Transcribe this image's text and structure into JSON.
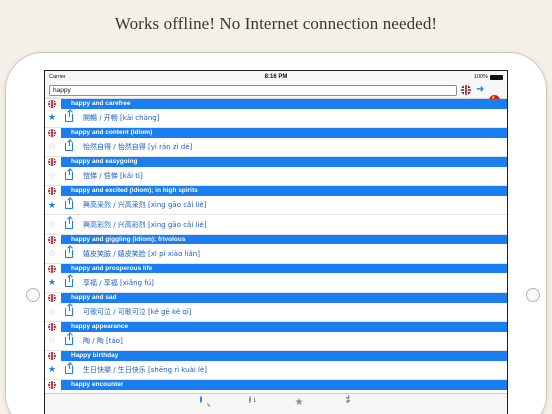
{
  "headline": "Works offline! No Internet connection needed!",
  "statusbar": {
    "carrier": "Carrier",
    "time": "8:16 PM",
    "battery": "100%"
  },
  "search": {
    "value": "happy"
  },
  "colors": {
    "accent": "#1a7df0",
    "background": "#f4f0e9"
  },
  "icons": {
    "source_language": "uk-flag-icon",
    "target_language": "china-flag-icon"
  },
  "rows": [
    {
      "type": "header",
      "text": "happy and carefree"
    },
    {
      "type": "entry",
      "starred": true,
      "text": "開暢 / 开畅 [kāi chàng]"
    },
    {
      "type": "header",
      "text": "happy and content (idiom)"
    },
    {
      "type": "entry",
      "starred": false,
      "text": "怡然自得 / 怡然自得 [yí rán zì dé]"
    },
    {
      "type": "header",
      "text": "happy and easygoing"
    },
    {
      "type": "entry",
      "starred": false,
      "text": "愷悌 / 恺悌 [kǎi tì]"
    },
    {
      "type": "header",
      "text": "happy and excited (idiom); in high spirits"
    },
    {
      "type": "entry",
      "starred": true,
      "text": "興高采烈 / 兴高采烈 [xìng gāo cǎi liè]"
    },
    {
      "type": "entry",
      "starred": false,
      "text": "興高彩烈 / 兴高彩烈 [xìng gāo cǎi liè]"
    },
    {
      "type": "header",
      "text": "happy and giggling (idiom); frivolous"
    },
    {
      "type": "entry",
      "starred": false,
      "text": "嬉皮笑臉 / 嬉皮笑脸 [xī pí xiào liǎn]"
    },
    {
      "type": "header",
      "text": "happy and prosperous life"
    },
    {
      "type": "entry",
      "starred": true,
      "text": "享福 / 享福 [xiǎng fú]"
    },
    {
      "type": "header",
      "text": "happy and sad"
    },
    {
      "type": "entry",
      "starred": false,
      "text": "可歌可泣 / 可歌可泣 [kě gē kě qì]"
    },
    {
      "type": "header",
      "text": "happy appearance"
    },
    {
      "type": "entry",
      "starred": false,
      "text": "陶 / 陶 [táo]"
    },
    {
      "type": "header",
      "text": "Happy birthday"
    },
    {
      "type": "entry",
      "starred": true,
      "text": "生日快樂 / 生日快乐 [shēng rì kuài lè]"
    },
    {
      "type": "header",
      "text": "happy encounter"
    }
  ],
  "tabs": [
    {
      "name": "search",
      "active": true
    },
    {
      "name": "history",
      "active": false
    },
    {
      "name": "favorites",
      "active": false
    },
    {
      "name": "settings",
      "active": false
    }
  ]
}
